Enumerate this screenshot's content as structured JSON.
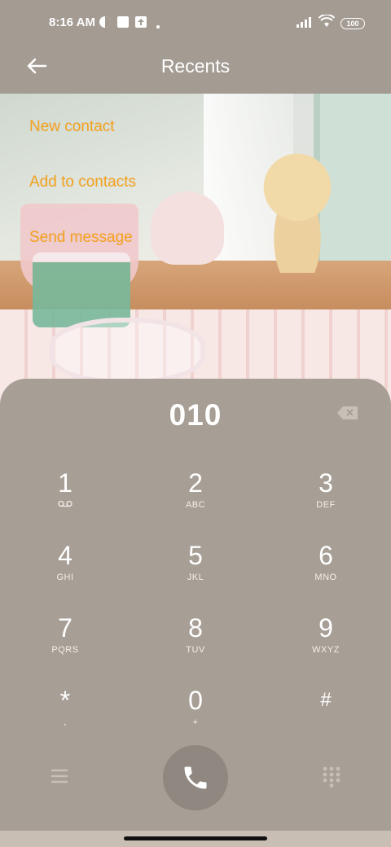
{
  "status": {
    "time": "8:16 AM",
    "battery": "100"
  },
  "header": {
    "title": "Recents"
  },
  "actions": [
    "New contact",
    "Add to contacts",
    "Send message"
  ],
  "dialer": {
    "number": "010",
    "keys": [
      {
        "digit": "1",
        "letters": "voicemail"
      },
      {
        "digit": "2",
        "letters": "ABC"
      },
      {
        "digit": "3",
        "letters": "DEF"
      },
      {
        "digit": "4",
        "letters": "GHI"
      },
      {
        "digit": "5",
        "letters": "JKL"
      },
      {
        "digit": "6",
        "letters": "MNO"
      },
      {
        "digit": "7",
        "letters": "PQRS"
      },
      {
        "digit": "8",
        "letters": "TUV"
      },
      {
        "digit": "9",
        "letters": "WXYZ"
      },
      {
        "digit": "*",
        "letters": ","
      },
      {
        "digit": "0",
        "letters": "+"
      },
      {
        "digit": "#",
        "letters": ""
      }
    ]
  },
  "icons": {
    "back": "arrow-left-icon",
    "backspace": "backspace-icon",
    "menu": "menu-icon",
    "call": "phone-icon",
    "dialpad": "dialpad-icon"
  },
  "colors": {
    "accent": "#f5a21f",
    "panel": "#a79f96",
    "call_button": "#8f8780"
  }
}
